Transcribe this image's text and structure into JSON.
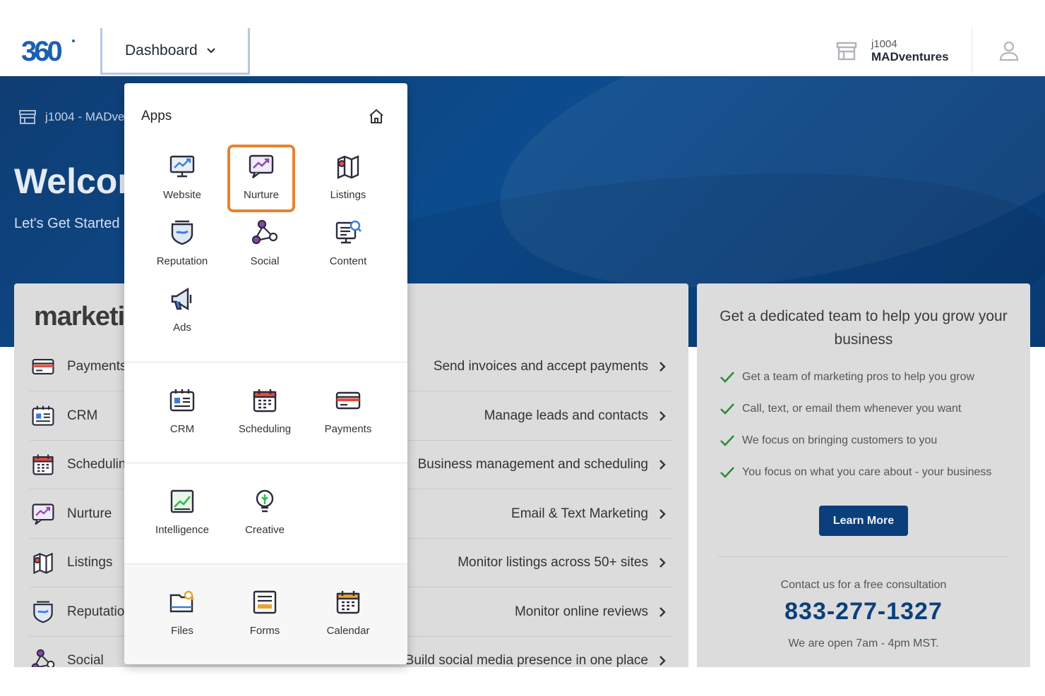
{
  "header": {
    "logo_text": "360",
    "dashboard_label": "Dashboard",
    "account_id": "j1004",
    "account_name": "MADventures"
  },
  "hero": {
    "breadcrumb": "j1004 - MADventures",
    "welcome": "Welcome",
    "subtitle": "Let's Get Started"
  },
  "apps_menu": {
    "title": "Apps",
    "sections": [
      [
        {
          "label": "Website",
          "icon": "website-icon"
        },
        {
          "label": "Nurture",
          "icon": "nurture-icon",
          "selected": true
        },
        {
          "label": "Listings",
          "icon": "listings-icon"
        },
        {
          "label": "Reputation",
          "icon": "reputation-icon"
        },
        {
          "label": "Social",
          "icon": "social-icon"
        },
        {
          "label": "Content",
          "icon": "content-icon"
        },
        {
          "label": "Ads",
          "icon": "ads-icon"
        }
      ],
      [
        {
          "label": "CRM",
          "icon": "crm-icon"
        },
        {
          "label": "Scheduling",
          "icon": "scheduling-icon"
        },
        {
          "label": "Payments",
          "icon": "payments-icon"
        }
      ],
      [
        {
          "label": "Intelligence",
          "icon": "intelligence-icon"
        },
        {
          "label": "Creative",
          "icon": "creative-icon"
        }
      ],
      [
        {
          "label": "Files",
          "icon": "files-icon"
        },
        {
          "label": "Forms",
          "icon": "forms-icon"
        },
        {
          "label": "Calendar",
          "icon": "calendar-icon"
        }
      ]
    ]
  },
  "marketing": {
    "title": "marketing",
    "rows": [
      {
        "name": "Payments",
        "desc": "Send invoices and accept payments",
        "icon": "payments-icon"
      },
      {
        "name": "CRM",
        "desc": "Manage leads and contacts",
        "icon": "crm-icon"
      },
      {
        "name": "Scheduling",
        "desc": "Business management and scheduling",
        "icon": "scheduling-icon"
      },
      {
        "name": "Nurture",
        "desc": "Email & Text Marketing",
        "icon": "nurture-icon"
      },
      {
        "name": "Listings",
        "desc": "Monitor listings across 50+ sites",
        "icon": "listings-icon"
      },
      {
        "name": "Reputation",
        "desc": "Monitor online reviews",
        "icon": "reputation-icon"
      },
      {
        "name": "Social",
        "desc": "Build social media presence in one place",
        "icon": "social-icon"
      }
    ]
  },
  "team_card": {
    "title": "Get a dedicated team to help you grow your business",
    "checks": [
      "Get a team of marketing pros to help you grow",
      "Call, text, or email them whenever you want",
      "We focus on bringing customers to you",
      "You focus on what you care about - your business"
    ],
    "cta": "Learn More",
    "contact_text": "Contact us for a free consultation",
    "phone": "833-277-1327",
    "hours": "We are open 7am - 4pm MST."
  },
  "colors": {
    "brand_blue": "#0b3f7c",
    "highlight_orange": "#e8822e",
    "check_green": "#2e8b3e"
  }
}
